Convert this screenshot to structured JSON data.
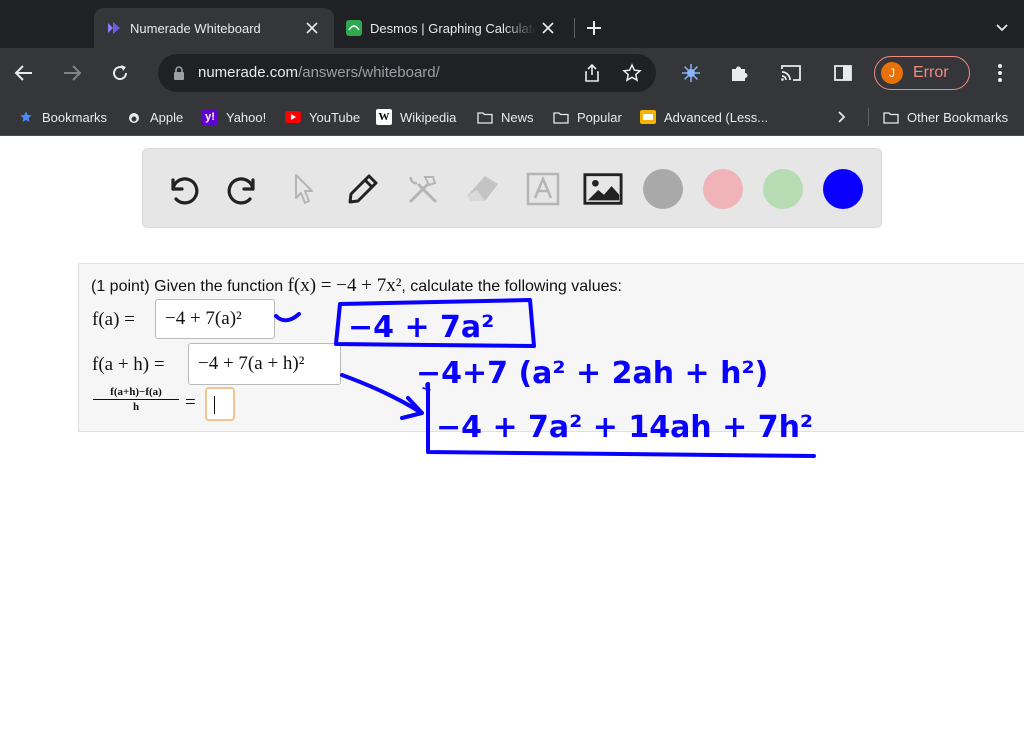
{
  "browser": {
    "tabs": [
      {
        "title": "Numerade Whiteboard",
        "active": true,
        "favicon": "numerade-logo-icon"
      },
      {
        "title": "Desmos | Graphing Calculator",
        "active": false,
        "favicon": "desmos-logo-icon"
      }
    ],
    "url_host": "numerade.com",
    "url_path": "/answers/whiteboard/",
    "profile_initial": "J",
    "profile_status": "Error",
    "colors": {
      "tabstrip": "#202124",
      "toolbar": "#35363a",
      "error": "#f28b82",
      "avatar": "#e8710a"
    }
  },
  "bookmarks": {
    "items": [
      {
        "label": "Bookmarks",
        "icon": "star-icon"
      },
      {
        "label": "Apple",
        "icon": "apple-icon"
      },
      {
        "label": "Yahoo!",
        "icon": "yahoo-icon"
      },
      {
        "label": "YouTube",
        "icon": "youtube-icon"
      },
      {
        "label": "Wikipedia",
        "icon": "wikipedia-icon"
      },
      {
        "label": "News",
        "icon": "folder-icon"
      },
      {
        "label": "Popular",
        "icon": "folder-icon"
      },
      {
        "label": "Advanced (Less...",
        "icon": "doc-icon"
      }
    ],
    "other": "Other Bookmarks"
  },
  "whiteboard": {
    "tools": [
      "undo-icon",
      "redo-icon",
      "pointer-icon",
      "pen-icon",
      "tools-icon",
      "eraser-icon",
      "text-icon",
      "image-icon"
    ],
    "swatches": [
      {
        "name": "gray",
        "color": "#a9a9a9"
      },
      {
        "name": "pink",
        "color": "#f0b3b8"
      },
      {
        "name": "green",
        "color": "#b7dbb3"
      },
      {
        "name": "blue",
        "color": "#0a00ff",
        "selected": true
      }
    ]
  },
  "problem": {
    "intro_prefix": "(1 point) Given the function ",
    "function_expr": "f(x) = −4 + 7x²",
    "intro_suffix": ", calculate the following values:",
    "row1": {
      "lhs": "f(a) =",
      "answer": "−4 + 7(a)²"
    },
    "row2": {
      "lhs": "f(a + h) =",
      "answer": "−4 + 7(a + h)²"
    },
    "row3": {
      "numerator": "f(a+h)−f(a)",
      "denominator": "h",
      "equals": "="
    }
  },
  "handwriting": {
    "color": "#0a00ff",
    "line1": "−4 + 7a²",
    "line2": "−4+7 (a² + 2ah + h²)",
    "line3": "−4 + 7a² + 14ah + 7h²"
  }
}
